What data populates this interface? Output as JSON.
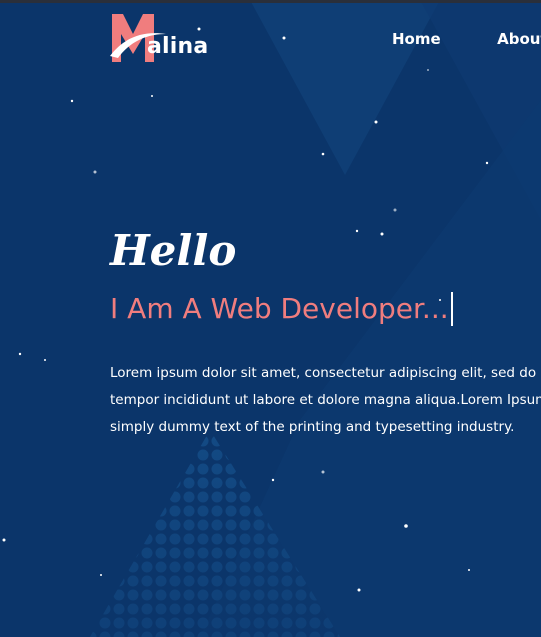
{
  "brand": {
    "logo_letter": "M",
    "logo_text": "alina"
  },
  "nav": {
    "items": [
      "Home",
      "About"
    ]
  },
  "hero": {
    "greeting": "Hello",
    "headline": "I Am A Web Developer...",
    "description_lines": [
      "Lorem ipsum dolor sit amet, consectetur adipiscing elit, sed do eiu",
      "tempor incididunt ut labore et dolore magna aliqua.Lorem Ipsum is",
      "simply dummy text of the printing and typesetting industry."
    ]
  },
  "colors": {
    "background": "#0b356a",
    "accent": "#f07d7e",
    "text": "#ffffff"
  },
  "icons": [
    "typing-cursor-icon"
  ]
}
